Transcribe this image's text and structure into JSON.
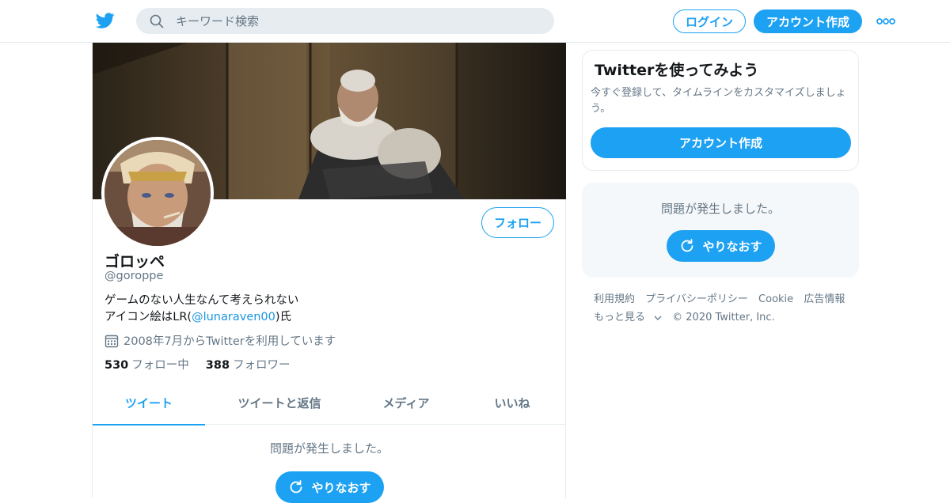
{
  "header": {
    "search_placeholder": "キーワード検索",
    "login_label": "ログイン",
    "signup_label": "アカウント作成"
  },
  "profile": {
    "follow_label": "フォロー",
    "name": "ゴロッペ",
    "handle": "@goroppe",
    "bio_line1": "ゲームのない人生なんて考えられない",
    "bio_line2_prefix": "アイコン絵はLR(",
    "bio_mention": "@lunaraven00",
    "bio_line2_suffix": ")氏",
    "joined": "2008年7月からTwitterを利用しています",
    "following_count": "530",
    "following_label": "フォロー中",
    "followers_count": "388",
    "followers_label": "フォロワー"
  },
  "tabs": [
    {
      "label": "ツイート",
      "active": true
    },
    {
      "label": "ツイートと返信",
      "active": false
    },
    {
      "label": "メディア",
      "active": false
    },
    {
      "label": "いいね",
      "active": false
    }
  ],
  "timeline": {
    "error_text": "問題が発生しました。",
    "retry_label": "やりなおす"
  },
  "sidebar": {
    "signup_card": {
      "title": "Twitterを使ってみよう",
      "description": "今すぐ登録して、タイムラインをカスタマイズしましょう。",
      "button_label": "アカウント作成"
    },
    "error_card": {
      "error_text": "問題が発生しました。",
      "retry_label": "やりなおす"
    },
    "footer": {
      "terms": "利用規約",
      "privacy": "プライバシーポリシー",
      "cookie": "Cookie",
      "ads": "広告情報",
      "more": "もっと見る",
      "copyright": "© 2020 Twitter, Inc."
    }
  },
  "colors": {
    "accent": "#1da1f2",
    "text_secondary": "#657786",
    "link": "#1b95e0"
  }
}
